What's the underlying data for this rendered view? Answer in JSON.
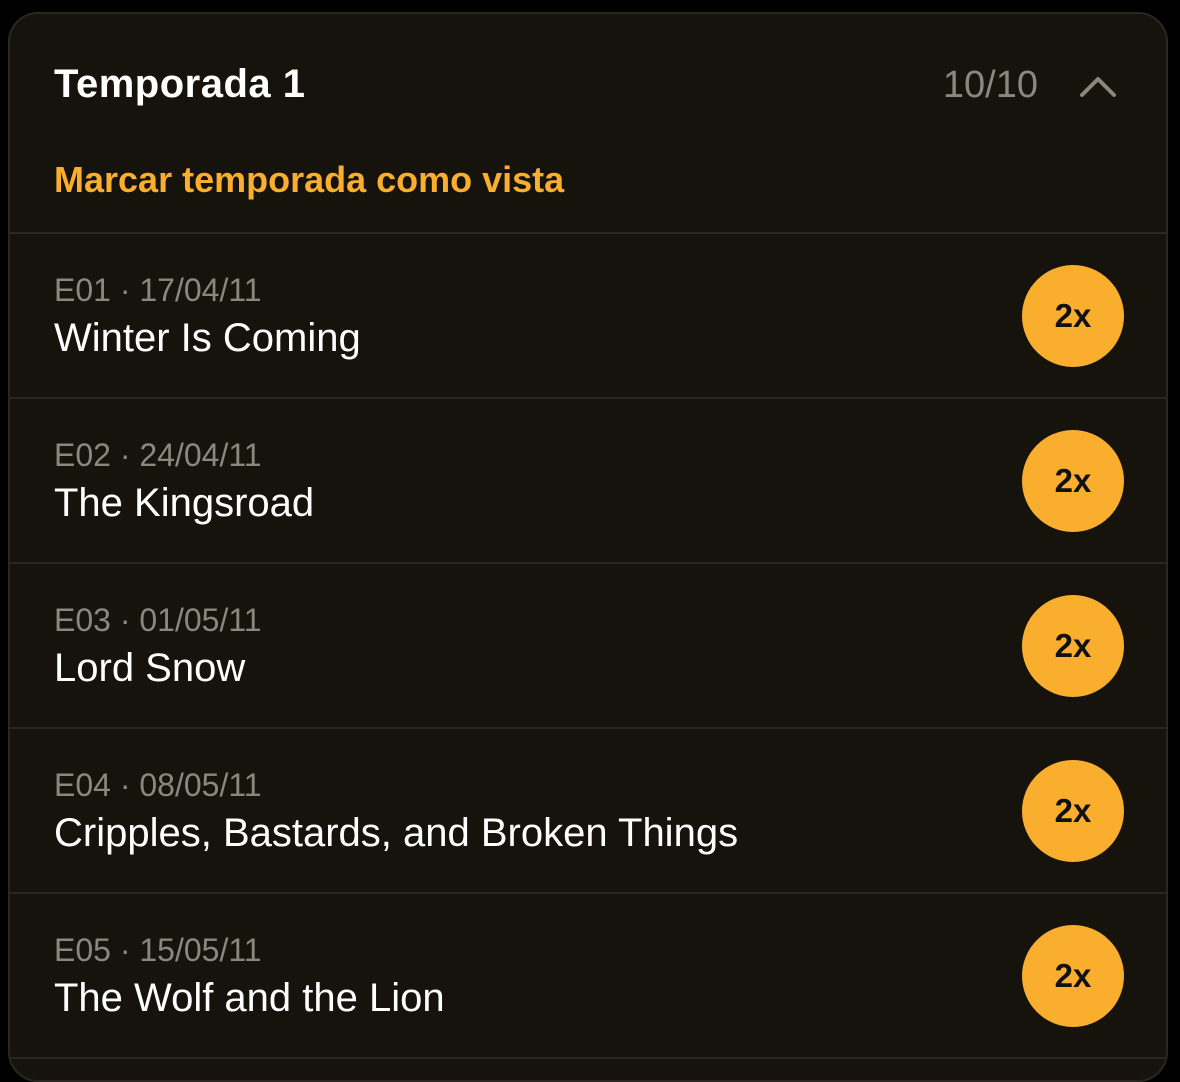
{
  "season": {
    "title": "Temporada 1",
    "progress": "10/10",
    "collapse_icon": "chevron-up-icon",
    "mark_watched_label": "Marcar temporada como vista"
  },
  "episodes": [
    {
      "code": "E01",
      "sep": "·",
      "date": "17/04/11",
      "title": "Winter Is Coming",
      "badge": "2x"
    },
    {
      "code": "E02",
      "sep": "·",
      "date": "24/04/11",
      "title": "The Kingsroad",
      "badge": "2x"
    },
    {
      "code": "E03",
      "sep": "·",
      "date": "01/05/11",
      "title": "Lord Snow",
      "badge": "2x"
    },
    {
      "code": "E04",
      "sep": "·",
      "date": "08/05/11",
      "title": "Cripples, Bastards, and Broken Things",
      "badge": "2x"
    },
    {
      "code": "E05",
      "sep": "·",
      "date": "15/05/11",
      "title": "The Wolf and the Lion",
      "badge": "2x"
    }
  ],
  "colors": {
    "background": "#000000",
    "card": "#16130d",
    "divider": "#2b2720",
    "accent": "#f9ae2e",
    "muted_text": "#8c877c",
    "primary_text": "#ffffff"
  }
}
